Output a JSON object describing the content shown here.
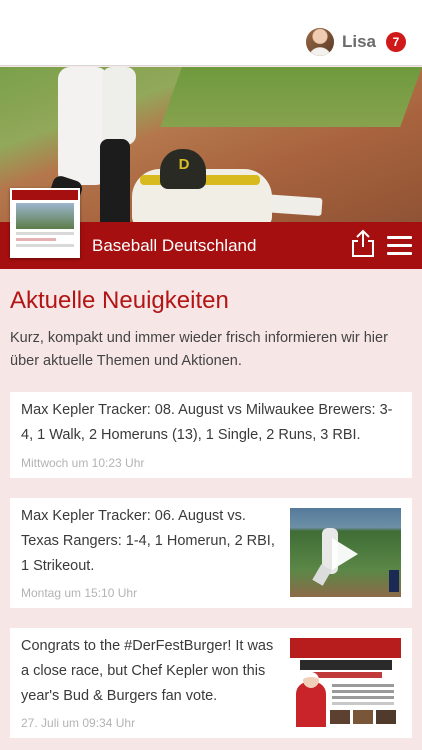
{
  "header": {
    "username": "Lisa",
    "notification_count": "7"
  },
  "site": {
    "title": "Baseball Deutschland"
  },
  "section": {
    "heading": "Aktuelle Neuigkeiten",
    "intro": "Kurz, kompakt und immer wieder frisch informieren wir hier über aktuelle Themen und Aktionen."
  },
  "news": [
    {
      "title": "Max Kepler Tracker: 08. August vs Milwaukee Brewers: 3-4, 1 Walk, 2 Homeruns (13), 1 Single, 2 Runs, 3 RBI.",
      "time": "Mittwoch um 10:23 Uhr"
    },
    {
      "title": "Max Kepler Tracker: 06. August vs. Texas Rangers: 1-4, 1 Homerun, 2 RBI, 1 Strikeout.",
      "time": "Montag um 15:10 Uhr",
      "media": "video-thumbnail"
    },
    {
      "title": "Congrats to the #DerFestBurger! It was a close race, but Chef Kepler won this year's Bud & Burgers fan vote.",
      "time": "27. Juli um 09:34 Uhr",
      "media": "image-thumbnail"
    }
  ],
  "colors": {
    "brand_red": "#a50f0f",
    "heading_red": "#b31414",
    "page_background": "#f7e6e6",
    "badge_red": "#d01a1a"
  },
  "icons": [
    "share-icon",
    "hamburger-menu-icon",
    "play-icon"
  ]
}
